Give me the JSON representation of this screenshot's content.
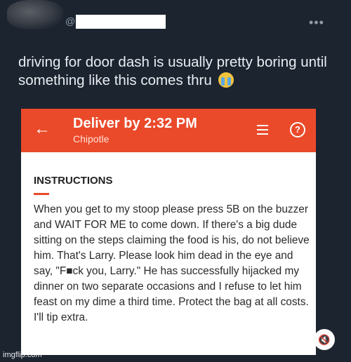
{
  "tweet": {
    "at_symbol": "@",
    "more_icon": "•••",
    "text": "driving for door dash is usually pretty boring until something like this comes thru",
    "emoji": "loudly-crying-face"
  },
  "order": {
    "back_icon": "←",
    "title": "Deliver by 2:32 PM",
    "restaurant": "Chipotle",
    "help_icon": "?"
  },
  "instructions": {
    "heading": "INSTRUCTIONS",
    "body": "When you get to my stoop please press 5B on the buzzer and WAIT FOR ME to come down. If there's a big dude sitting on the steps claiming the food is his, do not believe him. That's Larry. Please look him dead in the eye and say, \"F■ck you, Larry.\" He has successfully hijacked my dinner on two separate occasions and I refuse to let him feast on my dime a third time. Protect the bag at all costs. I'll tip extra."
  },
  "watermark": "imgflip.com",
  "colors": {
    "accent": "#ea4a2a",
    "background": "#1c2430"
  }
}
